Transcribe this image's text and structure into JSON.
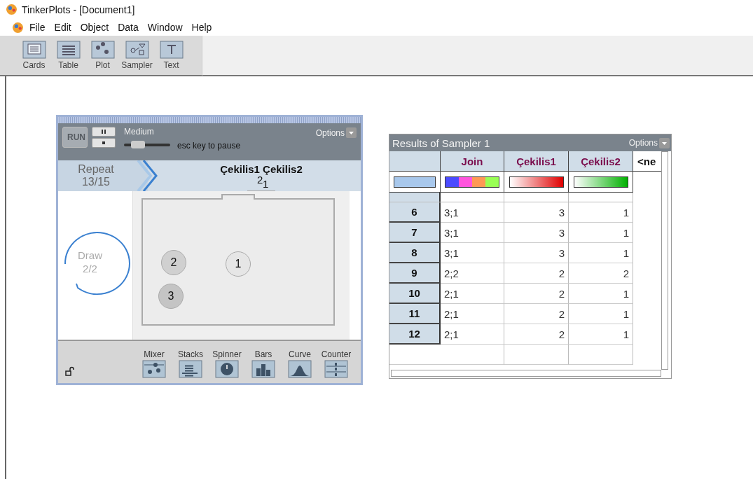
{
  "window": {
    "title": "TinkerPlots - [Document1]"
  },
  "menu": [
    "File",
    "Edit",
    "Object",
    "Data",
    "Window",
    "Help"
  ],
  "toolbar": [
    {
      "label": "Cards",
      "kind": "cards"
    },
    {
      "label": "Table",
      "kind": "table"
    },
    {
      "label": "Plot",
      "kind": "plot"
    },
    {
      "label": "Sampler",
      "kind": "sampler"
    },
    {
      "label": "Text",
      "kind": "text"
    }
  ],
  "sampler": {
    "run": "RUN",
    "speed": {
      "label": "Medium",
      "level": 0.3
    },
    "hint": "esc key to pause",
    "options": "Options",
    "repeat": {
      "label": "Repeat",
      "count": "13/15"
    },
    "attributes": "Çekilis1 Çekilis2",
    "outcome": [
      "2",
      "1"
    ],
    "draw": {
      "label": "Draw",
      "count": "2/2"
    },
    "balls": [
      {
        "label": "2",
        "color": "#d0d0d0"
      },
      {
        "label": "1",
        "color": "#e6e6e6"
      },
      {
        "label": "3",
        "color": "#c4c4c4"
      }
    ],
    "devices": [
      {
        "label": "Mixer",
        "kind": "mixer"
      },
      {
        "label": "Stacks",
        "kind": "stacks"
      },
      {
        "label": "Spinner",
        "kind": "spinner"
      },
      {
        "label": "Bars",
        "kind": "bars"
      },
      {
        "label": "Curve",
        "kind": "curve"
      },
      {
        "label": "Counter",
        "kind": "counter"
      }
    ]
  },
  "results": {
    "title": "Results of Sampler 1",
    "options": "Options",
    "columns": [
      {
        "name": "Join",
        "kind": "categorical"
      },
      {
        "name": "Çekilis1",
        "kind": "numeric"
      },
      {
        "name": "Çekilis2",
        "kind": "numeric"
      },
      {
        "name": "<ne",
        "kind": "new"
      }
    ],
    "rows": [
      {
        "index": "6",
        "cells": [
          "3;1",
          "3",
          "1"
        ]
      },
      {
        "index": "7",
        "cells": [
          "3;1",
          "3",
          "1"
        ]
      },
      {
        "index": "8",
        "cells": [
          "3;1",
          "3",
          "1"
        ]
      },
      {
        "index": "9",
        "cells": [
          "2;2",
          "2",
          "2"
        ]
      },
      {
        "index": "10",
        "cells": [
          "2;1",
          "2",
          "1"
        ]
      },
      {
        "index": "11",
        "cells": [
          "2;1",
          "2",
          "1"
        ]
      },
      {
        "index": "12",
        "cells": [
          "2;1",
          "2",
          "1"
        ]
      }
    ]
  }
}
